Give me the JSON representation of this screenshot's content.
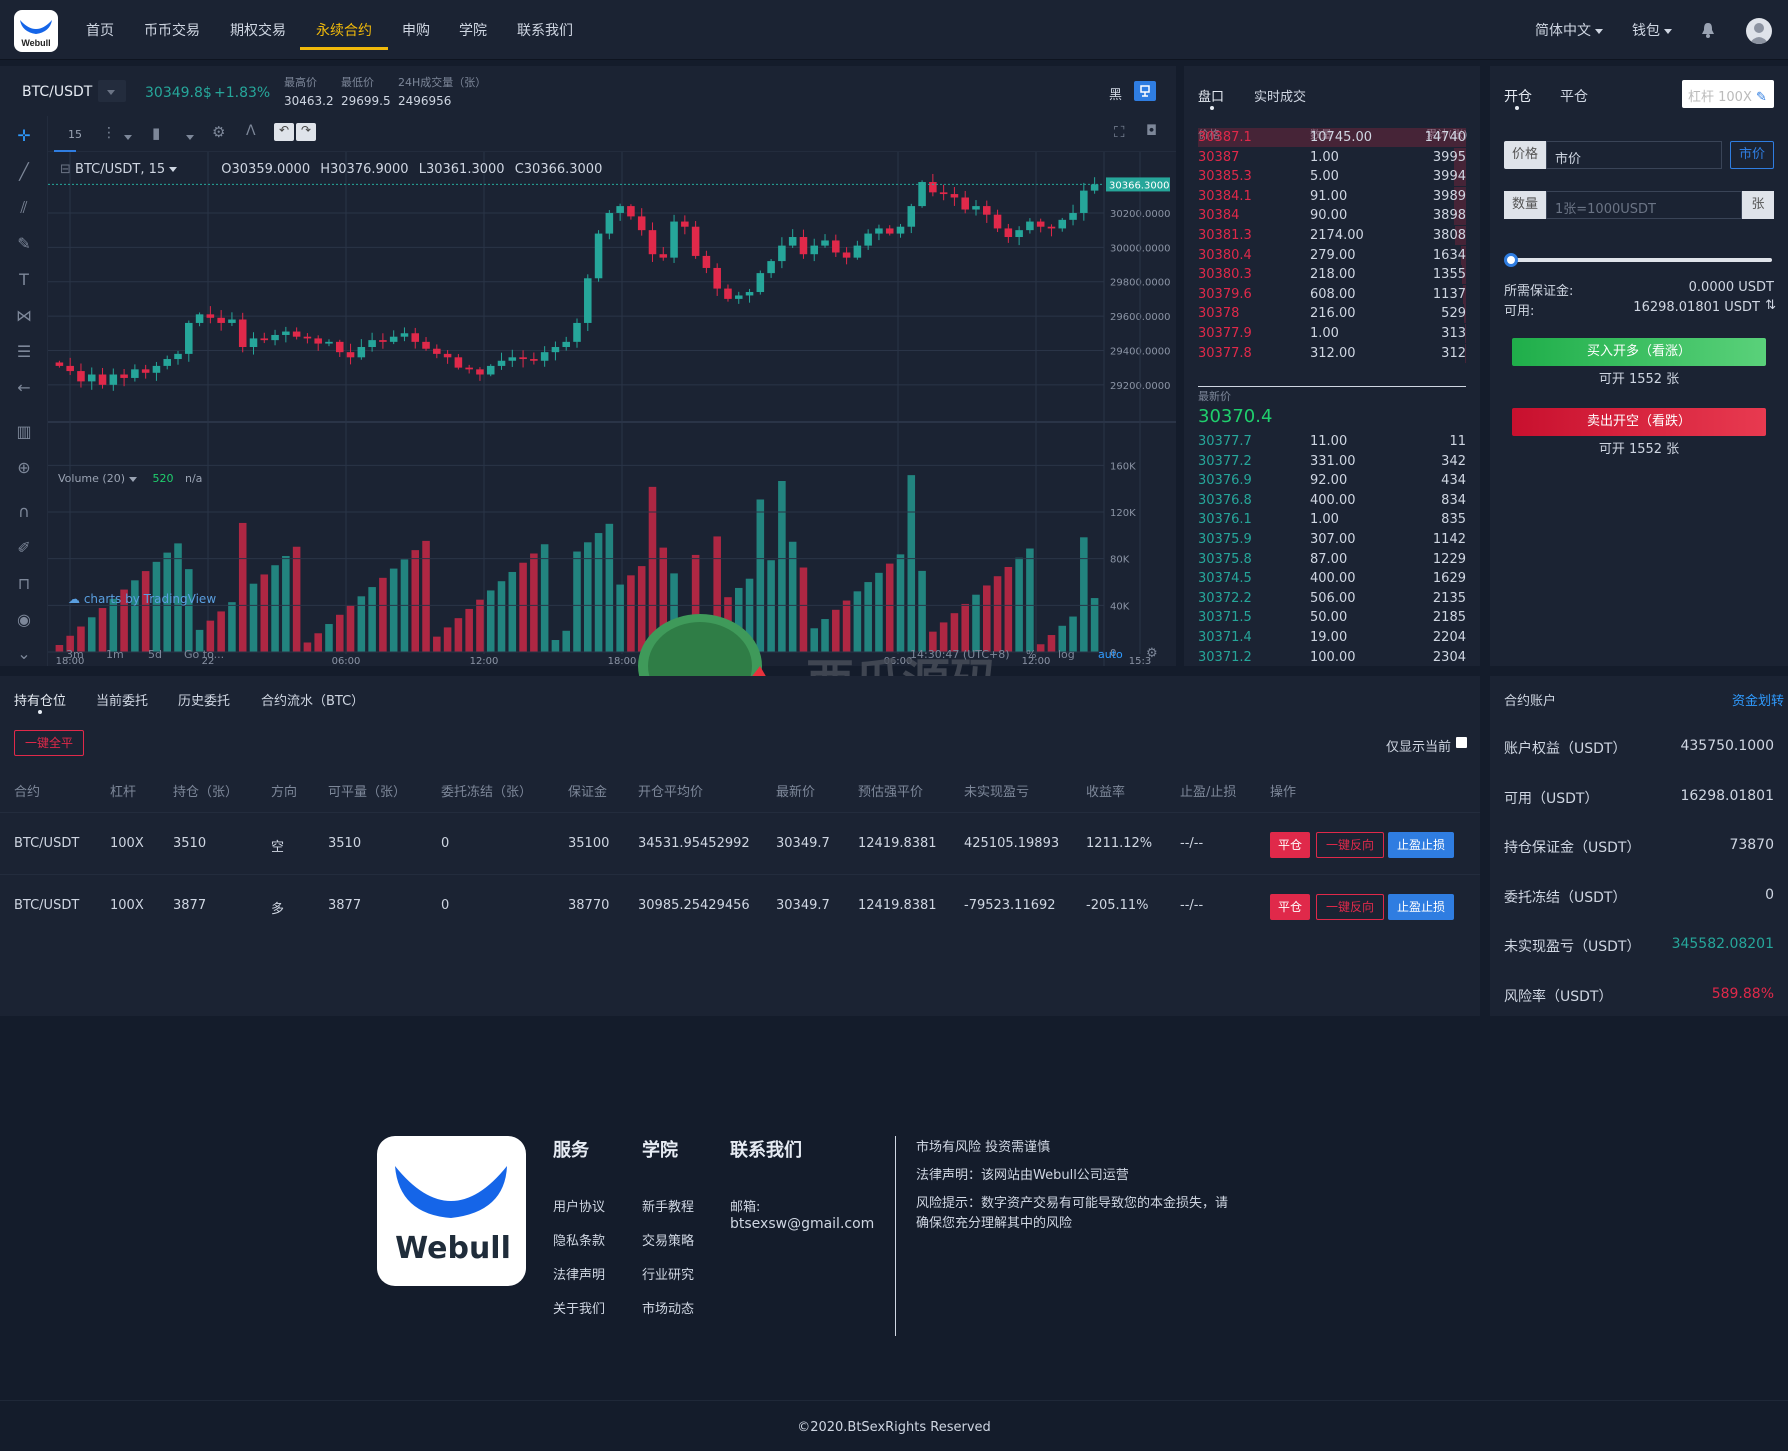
{
  "nav": {
    "items": [
      "首页",
      "币币交易",
      "期权交易",
      "永续合约",
      "申购",
      "学院",
      "联系我们"
    ],
    "active_index": 3,
    "lang": "简体中文",
    "wallet": "钱包",
    "logo_text": "Webull"
  },
  "ticker": {
    "pair": "BTC/USDT",
    "price": "30349.8$",
    "change": "+1.83%",
    "high_label": "最高价",
    "high": "30463.2",
    "low_label": "最低价",
    "low": "29699.5",
    "vol_label": "24H成交量（张）",
    "vol": "2496956",
    "theme_label": "黑"
  },
  "chart": {
    "interval": "15",
    "legend_symbol": "BTC/USDT, 15",
    "ohlc": {
      "o": "O30359.0000",
      "h": "H30376.9000",
      "l": "L30361.3000",
      "c": "C30366.3000"
    },
    "volume_label": "Volume (20)",
    "volume_value": "520",
    "volume_na": "n/a",
    "credit": "charts by TradingView",
    "last_price_tag": "30366.3000",
    "ranges": [
      "3m",
      "1m",
      "5d",
      "Go to..."
    ],
    "time_display": "14:30:47 (UTC+8)",
    "pct": "%",
    "log": "log",
    "auto": "auto",
    "watermark": "西瓜源码"
  },
  "chart_data": {
    "type": "candlestick",
    "x_ticks": [
      "18:00",
      "22",
      "06:00",
      "12:00",
      "18:00",
      "06:00",
      "12:00",
      "15:3"
    ],
    "y_ticks": [
      "30200.0000",
      "30000.0000",
      "29800.0000",
      "29600.0000",
      "29400.0000",
      "29200.0000"
    ],
    "y_range": [
      29100,
      30450
    ],
    "volume_ticks": [
      "160K",
      "120K",
      "80K",
      "40K",
      "0"
    ],
    "volume_range": [
      0,
      180000
    ],
    "close": [
      29310,
      29280,
      29220,
      29260,
      29200,
      29260,
      29240,
      29290,
      29270,
      29310,
      29350,
      29380,
      29560,
      29610,
      29590,
      29560,
      29580,
      29420,
      29470,
      29460,
      29490,
      29510,
      29480,
      29470,
      29440,
      29450,
      29390,
      29360,
      29420,
      29460,
      29450,
      29480,
      29500,
      29450,
      29410,
      29380,
      29360,
      29300,
      29290,
      29260,
      29310,
      29340,
      29360,
      29350,
      29340,
      29390,
      29420,
      29450,
      29560,
      29820,
      30080,
      30200,
      30240,
      30180,
      30100,
      29960,
      29940,
      30150,
      30120,
      29950,
      29880,
      29760,
      29700,
      29720,
      29740,
      29850,
      29920,
      30010,
      30060,
      29960,
      30010,
      30040,
      29970,
      29940,
      30010,
      30080,
      30110,
      30080,
      30120,
      30240,
      30380,
      30320,
      30310,
      30290,
      30220,
      30240,
      30190,
      30110,
      30060,
      30100,
      30150,
      30120,
      30110,
      30160,
      30200,
      30330,
      30366
    ]
  },
  "orderbook": {
    "tabs": [
      "盘口",
      "实时成交"
    ],
    "headers": [
      "价格",
      "数量",
      "累计(张)"
    ],
    "asks": [
      [
        "30387.1",
        "10745.00",
        "14740"
      ],
      [
        "30387",
        "1.00",
        "3995"
      ],
      [
        "30385.3",
        "5.00",
        "3994"
      ],
      [
        "30384.1",
        "91.00",
        "3989"
      ],
      [
        "30384",
        "90.00",
        "3898"
      ],
      [
        "30381.3",
        "2174.00",
        "3808"
      ],
      [
        "30380.4",
        "279.00",
        "1634"
      ],
      [
        "30380.3",
        "218.00",
        "1355"
      ],
      [
        "30379.6",
        "608.00",
        "1137"
      ],
      [
        "30378",
        "216.00",
        "529"
      ],
      [
        "30377.9",
        "1.00",
        "313"
      ],
      [
        "30377.8",
        "312.00",
        "312"
      ]
    ],
    "last_label": "最新价",
    "last_price": "30370.4",
    "bids": [
      [
        "30377.7",
        "11.00",
        "11"
      ],
      [
        "30377.2",
        "331.00",
        "342"
      ],
      [
        "30376.9",
        "92.00",
        "434"
      ],
      [
        "30376.8",
        "400.00",
        "834"
      ],
      [
        "30376.1",
        "1.00",
        "835"
      ],
      [
        "30375.9",
        "307.00",
        "1142"
      ],
      [
        "30375.8",
        "87.00",
        "1229"
      ],
      [
        "30374.5",
        "400.00",
        "1629"
      ],
      [
        "30372.2",
        "506.00",
        "2135"
      ],
      [
        "30371.5",
        "50.00",
        "2185"
      ],
      [
        "30371.4",
        "19.00",
        "2204"
      ],
      [
        "30371.2",
        "100.00",
        "2304"
      ]
    ]
  },
  "order_form": {
    "tabs": [
      "开仓",
      "平仓"
    ],
    "leverage": "杠杆 100X",
    "price_label": "价格",
    "price_value": "市价",
    "market_btn": "市价",
    "qty_label": "数量",
    "qty_placeholder": "1张=1000USDT",
    "qty_unit": "张",
    "margin_label": "所需保证金:",
    "margin_value": "0.0000 USDT",
    "avail_label": "可用:",
    "avail_value": "16298.01801 USDT",
    "slider": 0,
    "buy_label": "买入开多（看涨）",
    "buy_sub": "可开 1552 张",
    "sell_label": "卖出开空（看跌）",
    "sell_sub": "可开 1552 张"
  },
  "positions": {
    "tabs": [
      "持有仓位",
      "当前委托",
      "历史委托",
      "合约流水（BTC）"
    ],
    "close_all": "一键全平",
    "only_current": "仅显示当前",
    "headers": [
      "合约",
      "杠杆",
      "持仓（张）",
      "方向",
      "可平量（张）",
      "委托冻结（张）",
      "保证金",
      "开仓平均价",
      "最新价",
      "预估强平价",
      "未实现盈亏",
      "收益率",
      "止盈/止损",
      "操作"
    ],
    "rows": [
      [
        "BTC/USDT",
        "100X",
        "3510",
        "空",
        "3510",
        "0",
        "35100",
        "34531.95452992",
        "30349.7",
        "12419.8381",
        "425105.19893",
        "1211.12%",
        "--/--"
      ],
      [
        "BTC/USDT",
        "100X",
        "3877",
        "多",
        "3877",
        "0",
        "38770",
        "30985.25429456",
        "30349.7",
        "12419.8381",
        "-79523.11692",
        "-205.11%",
        "--/--"
      ]
    ],
    "action_close": "平仓",
    "action_reverse": "一键反向",
    "action_tpsl": "止盈止损"
  },
  "account": {
    "title": "合约账户",
    "transfer": "资金划转",
    "rows": [
      [
        "账户权益（USDT）",
        "435750.1000"
      ],
      [
        "可用（USDT）",
        "16298.01801"
      ],
      [
        "持仓保证金（USDT）",
        "73870"
      ],
      [
        "委托冻结（USDT）",
        "0"
      ],
      [
        "未实现盈亏（USDT）",
        "345582.08201"
      ],
      [
        "风险率（USDT）",
        "589.88%"
      ]
    ]
  },
  "footer": {
    "logo_text": "Webull",
    "col1_title": "服务",
    "col1": [
      "用户协议",
      "隐私条款",
      "法律声明",
      "关于我们"
    ],
    "col2_title": "学院",
    "col2": [
      "新手教程",
      "交易策略",
      "行业研究",
      "市场动态"
    ],
    "col3_title": "联系我们",
    "email_label": "邮箱:",
    "email": "btsexsw@gmail.com",
    "notice1": "市场有风险 投资需谨慎",
    "notice2": "法律声明：该网站由Webull公司运营",
    "notice3a": "风险提示：数字资产交易有可能导致您的本金损失，请",
    "notice3b": "确保您充分理解其中的风险",
    "copyright": "©2020.BtSexRights Reserved"
  },
  "colors": {
    "up": "#26a69a",
    "down": "#e0294a",
    "accent": "#f0b90b",
    "blue": "#2f7de1"
  }
}
